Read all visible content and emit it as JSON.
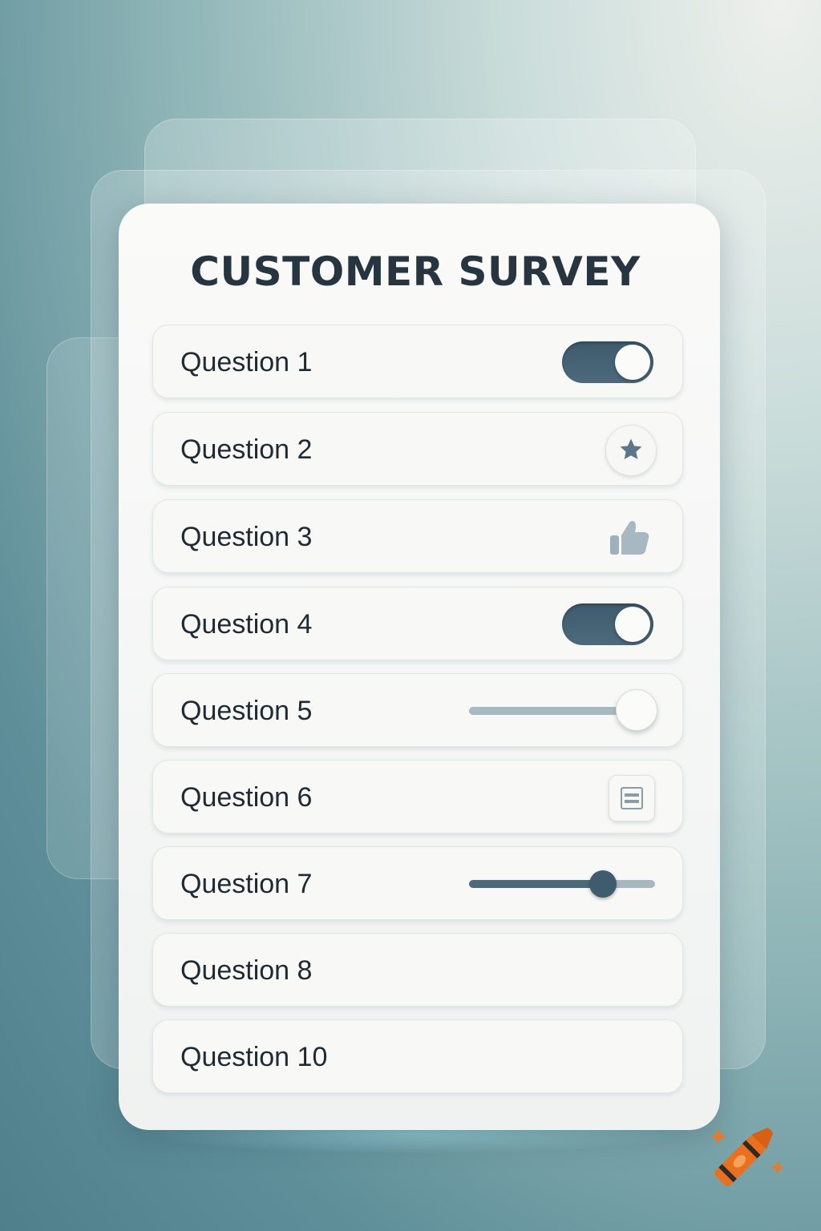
{
  "survey": {
    "title": "CUSTOMER SURVEY",
    "questions": [
      {
        "label": "Question 1",
        "control": "toggle",
        "value": "on"
      },
      {
        "label": "Question 2",
        "control": "star-button",
        "icon": "star-icon"
      },
      {
        "label": "Question 3",
        "control": "thumbs-up",
        "icon": "thumbs-up-icon"
      },
      {
        "label": "Question 4",
        "control": "toggle",
        "value": "on"
      },
      {
        "label": "Question 5",
        "control": "slider",
        "value": 0.9
      },
      {
        "label": "Question 6",
        "control": "form-button",
        "icon": "form-icon"
      },
      {
        "label": "Question 7",
        "control": "slider",
        "value": 0.72
      },
      {
        "label": "Question 8",
        "control": "none"
      },
      {
        "label": "Question 10",
        "control": "none"
      }
    ]
  },
  "colors": {
    "accent": "#3e5a6d",
    "title": "#263540",
    "logo": "#e86a1f"
  },
  "branding": {
    "logo_icon": "crayon-logo-icon"
  }
}
